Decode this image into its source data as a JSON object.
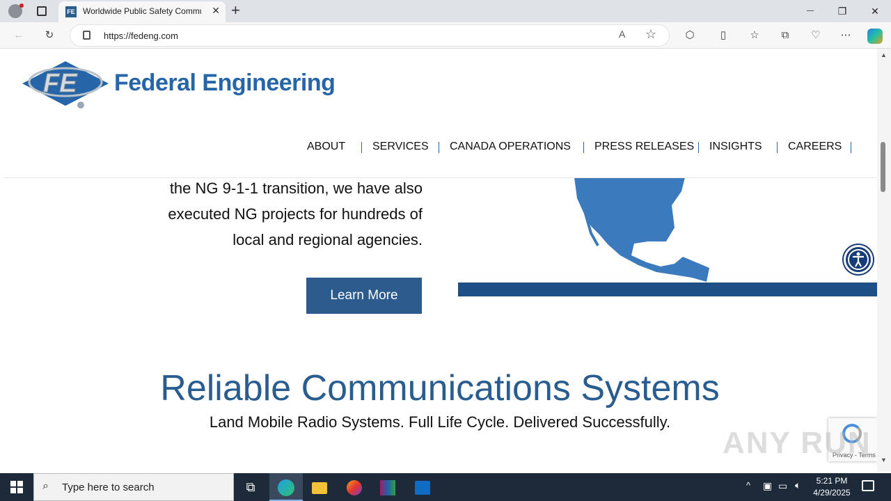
{
  "browser": {
    "tab_title": "Worldwide Public Safety Communications",
    "tab_favicon_text": "FE",
    "url": "https://fedeng.com",
    "new_tab": "+",
    "close_tab": "✕",
    "minimize": "—",
    "restore": "❐",
    "close_window": "✕"
  },
  "site": {
    "brand": "Federal Engineering",
    "logo_mark": "FE",
    "nav": [
      "ABOUT",
      "SERVICES",
      "CANADA OPERATIONS",
      "PRESS RELEASES",
      "INSIGHTS",
      "CAREERS"
    ],
    "body_lines": [
      "the NG 9-1-1 transition, we have also",
      "executed NG projects for hundreds of",
      "local and regional agencies."
    ],
    "cta": "Learn More",
    "section_title": "Reliable Communications Systems",
    "section_subtitle": "Land Mobile Radio Systems. Full Life Cycle. Delivered Successfully.",
    "recaptcha": "Privacy - Terms",
    "watermark": "ANY RUN"
  },
  "taskbar": {
    "search_placeholder": "Type here to search",
    "time": "5:21 PM",
    "date": "4/29/2025"
  },
  "colors": {
    "brand_blue": "#2565a8",
    "button_blue": "#2c5b8d",
    "map_blue": "#3b7bbd"
  }
}
